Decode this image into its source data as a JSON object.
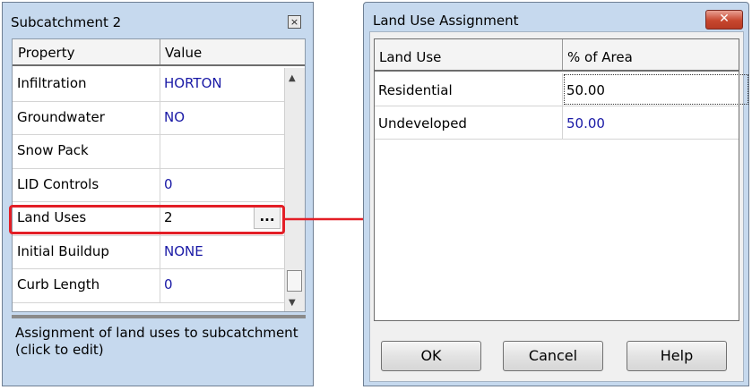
{
  "property_editor": {
    "title": "Subcatchment 2",
    "close_icon": "close-icon",
    "headers": {
      "property": "Property",
      "value": "Value"
    },
    "rows": [
      {
        "name": "Infiltration",
        "value": "HORTON"
      },
      {
        "name": "Groundwater",
        "value": "NO"
      },
      {
        "name": "Snow Pack",
        "value": ""
      },
      {
        "name": "LID Controls",
        "value": "0"
      },
      {
        "name": "Land Uses",
        "value": "2",
        "button": "..."
      },
      {
        "name": "Initial Buildup",
        "value": "NONE"
      },
      {
        "name": "Curb Length",
        "value": "0"
      }
    ],
    "description": "Assignment of land uses to subcatchment (click to edit)"
  },
  "land_use_dialog": {
    "title": "Land Use Assignment",
    "close_label": "✕",
    "headers": {
      "land_use": "Land Use",
      "pct_area": "% of Area"
    },
    "rows": [
      {
        "land_use": "Residential",
        "pct": "50.00"
      },
      {
        "land_use": "Undeveloped",
        "pct": "50.00"
      }
    ],
    "buttons": {
      "ok": "OK",
      "cancel": "Cancel",
      "help": "Help"
    }
  },
  "colors": {
    "highlight": "#e31e26",
    "value_text": "#1a1aa6",
    "window_frame": "#c6d9ee"
  }
}
